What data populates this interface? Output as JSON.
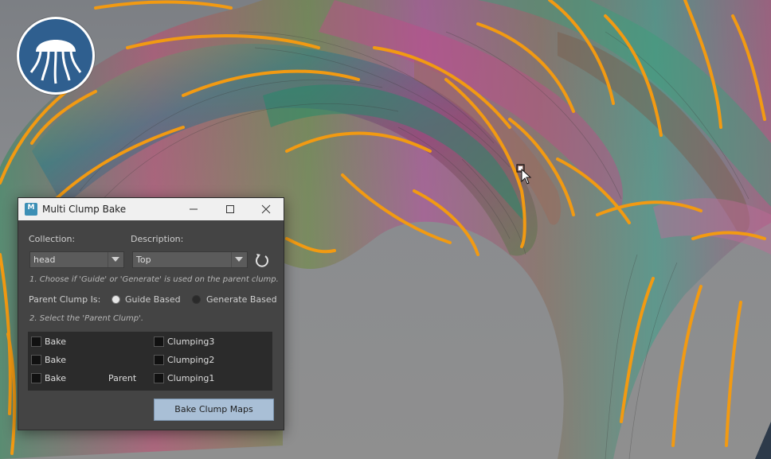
{
  "window": {
    "title": "Multi Clump Bake",
    "app_icon_letter": "M",
    "minimize_icon": "minimize-icon",
    "maximize_icon": "maximize-icon",
    "close_icon": "close-icon"
  },
  "form": {
    "collection_label": "Collection:",
    "description_label": "Description:",
    "collection_value": "head",
    "description_value": "Top",
    "refresh_icon": "refresh-icon",
    "step1_hint": "1. Choose if 'Guide' or 'Generate' is used on the parent clump.",
    "parent_clump_label": "Parent Clump Is:",
    "radio_options": [
      {
        "label": "Guide Based",
        "selected": true
      },
      {
        "label": "Generate Based",
        "selected": false
      }
    ],
    "step2_hint": "2. Select the 'Parent Clump'.",
    "rows": [
      {
        "bake_label": "Bake",
        "parent_label": "",
        "clump_label": "Clumping3"
      },
      {
        "bake_label": "Bake",
        "parent_label": "",
        "clump_label": "Clumping2"
      },
      {
        "bake_label": "Bake",
        "parent_label": "Parent",
        "clump_label": "Clumping1"
      }
    ],
    "bake_button_label": "Bake Clump Maps"
  },
  "colors": {
    "guide_curve": "#f29a12",
    "button_accent": "#a9bfd6",
    "dialog_bg": "#444444",
    "logo_blue": "#2f5f8f"
  },
  "viewport": {
    "logo_icon": "jellyfish-logo-icon",
    "cursor_icon": "arrow-cursor-icon"
  }
}
